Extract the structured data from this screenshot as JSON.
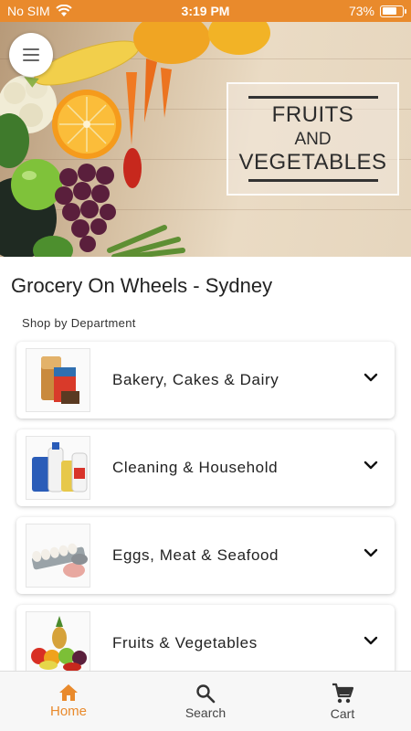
{
  "status_bar": {
    "carrier": "No SIM",
    "time": "3:19 PM",
    "battery_percent": "73%",
    "battery_level": 0.73
  },
  "hero": {
    "sign_line1": "FRUITS",
    "sign_line2": "AND",
    "sign_line3": "VEGETABLES"
  },
  "store": {
    "title": "Grocery On Wheels - Sydney",
    "section_label": "Shop by Department"
  },
  "departments": [
    {
      "label": "Bakery, Cakes & Dairy",
      "icon": "bakery-products-image"
    },
    {
      "label": "Cleaning & Household",
      "icon": "cleaning-products-image"
    },
    {
      "label": "Eggs, Meat & Seafood",
      "icon": "eggs-meat-seafood-image"
    },
    {
      "label": "Fruits & Vegetables",
      "icon": "fruits-vegetables-image"
    }
  ],
  "bottom_nav": {
    "home_label": "Home",
    "search_label": "Search",
    "cart_label": "Cart"
  },
  "colors": {
    "accent": "#e98a2c",
    "status_bar": "#e98a2c",
    "text": "#222222"
  }
}
